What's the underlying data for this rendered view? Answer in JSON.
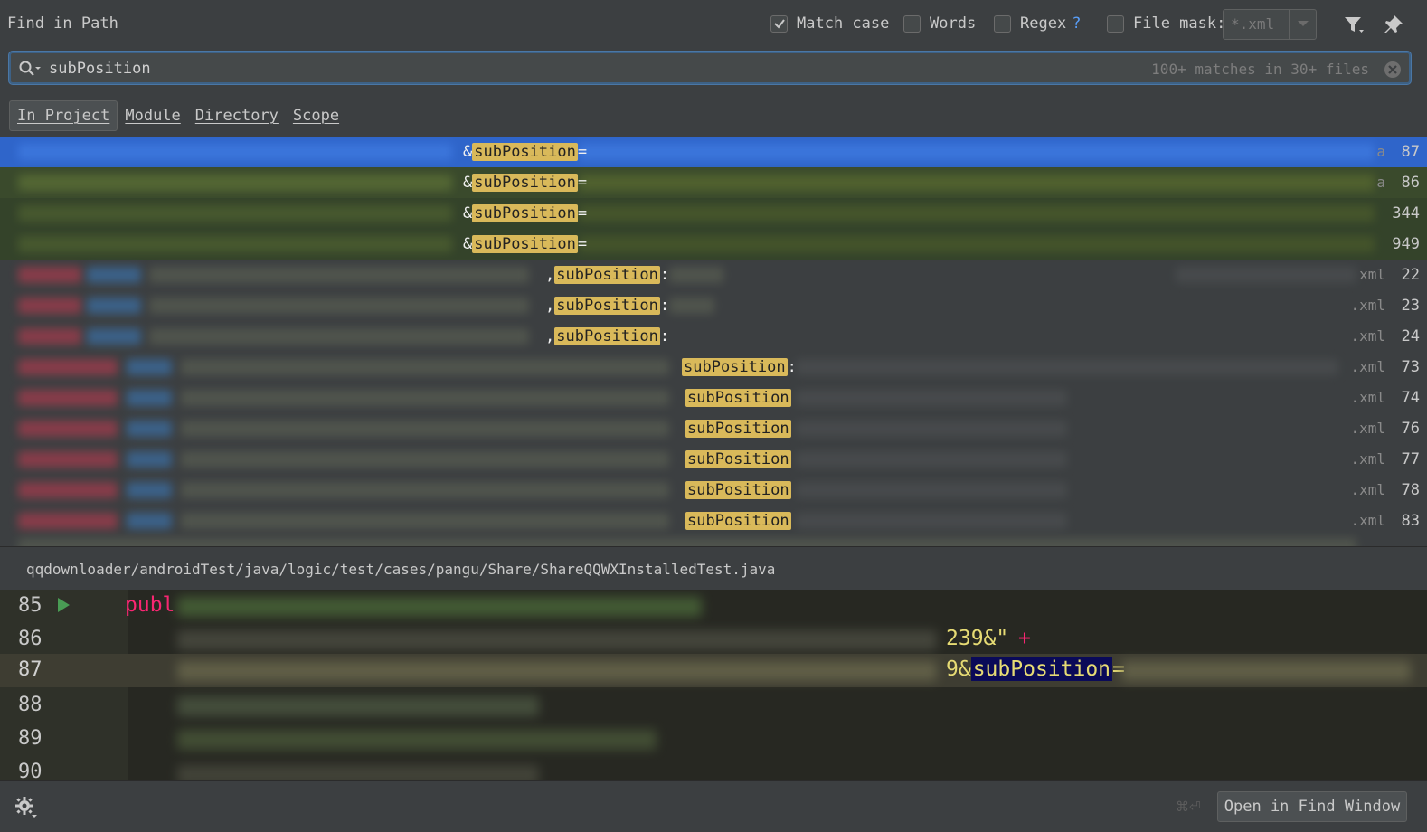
{
  "dialog": {
    "title": "Find in Path"
  },
  "options": {
    "match_case": {
      "label": "Match case",
      "checked": true
    },
    "words": {
      "label": "Words",
      "checked": false
    },
    "regex": {
      "label": "Regex",
      "help": "?",
      "checked": false
    },
    "file_mask": {
      "label": "File mask:",
      "checked": false,
      "value": "*.xml"
    }
  },
  "search": {
    "query": "subPosition",
    "match_summary": "100+ matches in 30+ files"
  },
  "scope": {
    "tabs": [
      {
        "label": "In Project",
        "active": true
      },
      {
        "label": "Module",
        "active": false
      },
      {
        "label": "Directory",
        "active": false
      },
      {
        "label": "Scope",
        "active": false
      }
    ]
  },
  "results": [
    {
      "before": "&",
      "match": "subPosition",
      "after": "=",
      "file": "a",
      "line": "87",
      "selected": true
    },
    {
      "before": "&",
      "match": "subPosition",
      "after": "=",
      "file": "a",
      "line": "86"
    },
    {
      "before": "&",
      "match": "subPosition",
      "after": "=",
      "file": "",
      "line": "344"
    },
    {
      "before": "&",
      "match": "subPosition",
      "after": "=",
      "file": "",
      "line": "949"
    },
    {
      "before": ",",
      "match": "subPosition",
      "after": ":",
      "file": "xml",
      "line": "22"
    },
    {
      "before": ",",
      "match": "subPosition",
      "after": ":",
      "file": ".xml",
      "line": "23"
    },
    {
      "before": ",",
      "match": "subPosition",
      "after": ":",
      "file": ".xml",
      "line": "24"
    },
    {
      "before": "",
      "match": "subPosition",
      "after": ":",
      "file": ".xml",
      "line": "73"
    },
    {
      "before": "",
      "match": "subPosition",
      "after": "",
      "file": ".xml",
      "line": "74"
    },
    {
      "before": "",
      "match": "subPosition",
      "after": "",
      "file": ".xml",
      "line": "76"
    },
    {
      "before": "",
      "match": "subPosition",
      "after": "",
      "file": ".xml",
      "line": "77"
    },
    {
      "before": "",
      "match": "subPosition",
      "after": "",
      "file": ".xml",
      "line": "78"
    },
    {
      "before": "",
      "match": "subPosition",
      "after": "",
      "file": ".xml",
      "line": "83"
    }
  ],
  "preview": {
    "path": "qqdownloader/androidTest/java/logic/test/cases/pangu/Share/ShareQQWXInstalledTest.java",
    "lines": [
      "85",
      "86",
      "87",
      "88",
      "89",
      "90"
    ],
    "current_line": "87",
    "line85_keyword": "publ",
    "line86_tail": "239&\"",
    "line86_op": "+",
    "line87_prefix": "9&",
    "line87_match": "subPosition",
    "line87_suffix": "="
  },
  "footer": {
    "shortcut": "⌘⏎",
    "open_button": "Open in Find Window"
  },
  "colors": {
    "accent": "#4a77a6",
    "selection": "#2f65ca",
    "match_highlight": "#d9b95a",
    "preview_bg": "#272822"
  }
}
